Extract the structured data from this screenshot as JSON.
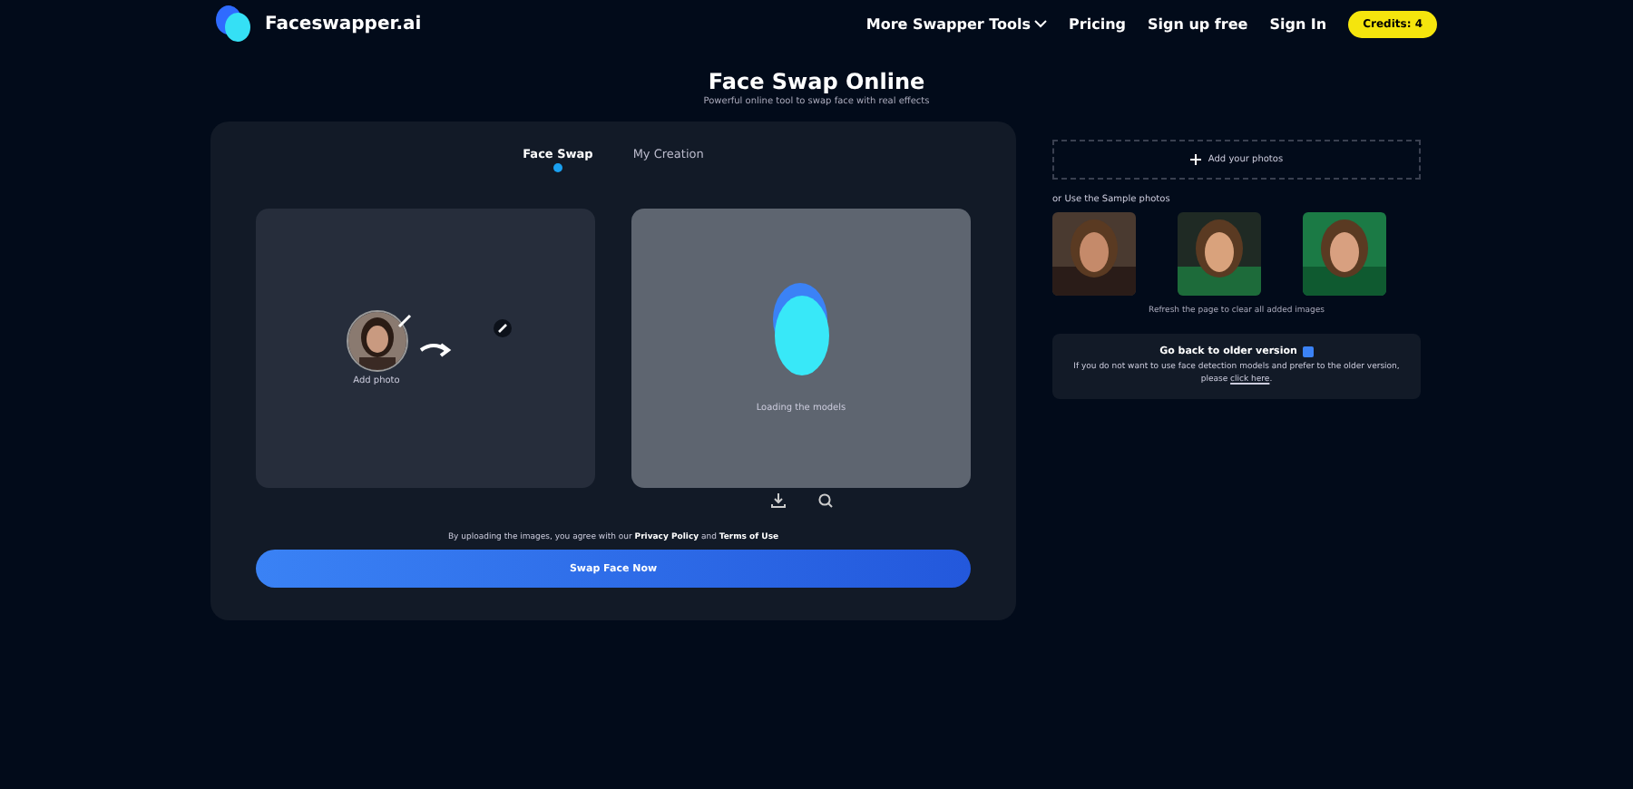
{
  "nav": {
    "brand": "Faceswapper.ai",
    "links": [
      {
        "label": "More Swapper Tools",
        "dropdown": true
      },
      {
        "label": "Pricing",
        "dropdown": false
      },
      {
        "label": "Sign up free",
        "dropdown": false
      },
      {
        "label": "Sign In",
        "dropdown": false
      }
    ],
    "credits": "Credits: 4"
  },
  "header": {
    "title": "Face Swap Online",
    "subtitle": "Powerful online tool to swap face with real effects"
  },
  "tabs": [
    {
      "label": "Face Swap",
      "selected": true
    },
    {
      "label": "My Creation",
      "selected": false
    }
  ],
  "source": {
    "label": "Add photo"
  },
  "result": {
    "status": "Loading the models"
  },
  "consent": [
    {
      "kind": "text",
      "text": "By uploading the images, you agree with our "
    },
    {
      "kind": "link",
      "text": "Privacy Policy"
    },
    {
      "kind": "text",
      "text": " and "
    },
    {
      "kind": "link",
      "text": "Terms of Use"
    }
  ],
  "swap_button": "Swap Face Now",
  "add_photos": "Add your photos",
  "samples_label": "or Use the Sample photos",
  "refresh_note": "Refresh the page to clear all added images",
  "older": {
    "title": "Go back to older version",
    "text": [
      {
        "kind": "text",
        "text": "If you do not want to use face detection models and prefer to the older version, please "
      },
      {
        "kind": "link",
        "text": "click here"
      },
      {
        "kind": "text",
        "text": "."
      }
    ]
  }
}
